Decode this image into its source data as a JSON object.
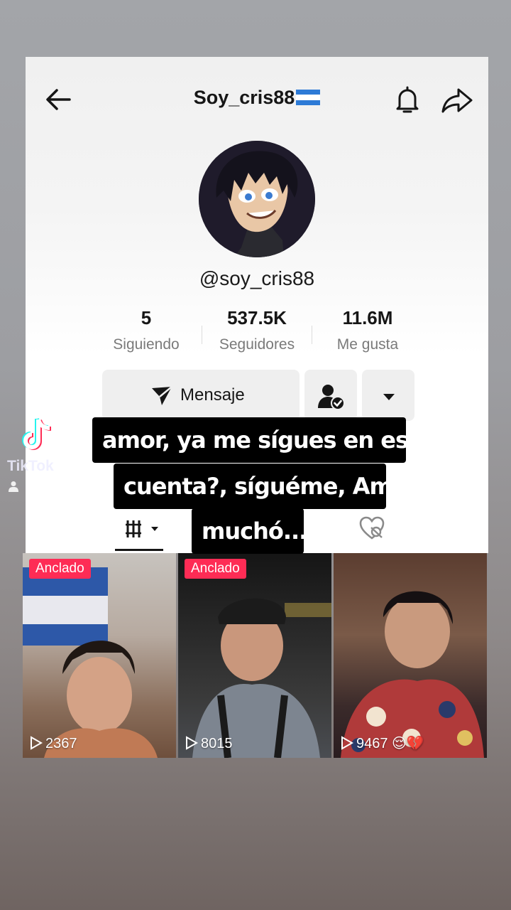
{
  "header": {
    "title": "Soy_cris88",
    "flag_icon": "honduras-flag-icon"
  },
  "profile": {
    "handle": "@soy_cris88"
  },
  "stats": [
    {
      "value": "5",
      "label": "Siguiendo"
    },
    {
      "value": "537.5K",
      "label": "Seguidores"
    },
    {
      "value": "11.6M",
      "label": "Me gusta"
    }
  ],
  "actions": {
    "message_label": "Mensaje"
  },
  "videos": [
    {
      "pinned_label": "Anclado",
      "views": "2367"
    },
    {
      "pinned_label": "Anclado",
      "views": "8015"
    },
    {
      "pinned_label": "",
      "views": "9467"
    }
  ],
  "caption": {
    "line1": "amor, ya me sígues en esta",
    "line2": "cuenta?, síguéme, Amó",
    "line3": "muchó..."
  },
  "watermark": {
    "brand": "TikTok"
  },
  "colors": {
    "accent": "#fe2c55",
    "text": "#161616",
    "muted": "#7a7a7a"
  }
}
